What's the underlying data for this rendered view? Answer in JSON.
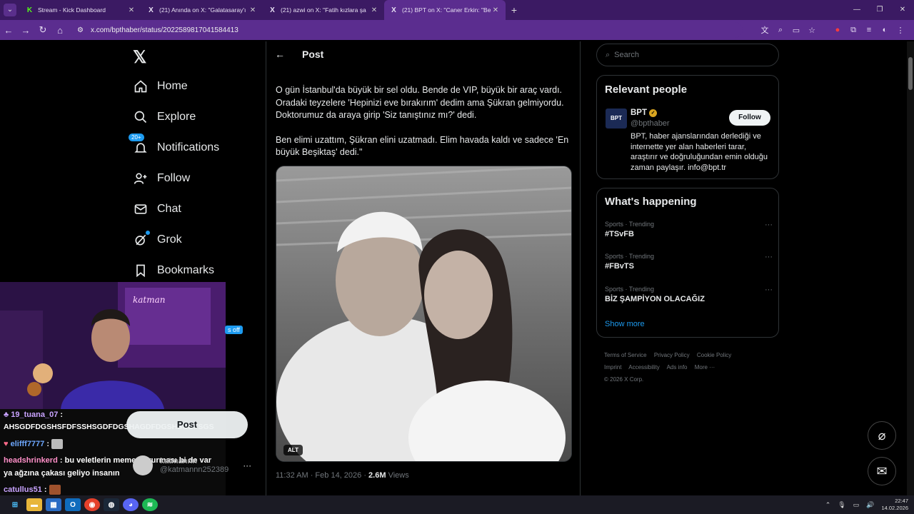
{
  "browser": {
    "tabs": [
      {
        "title": "Stream - Kick Dashboard",
        "favicon": "K",
        "active": false
      },
      {
        "title": "(21) Anında on X: \"Galatasaray'ı",
        "favicon": "X",
        "active": false
      },
      {
        "title": "(21) azwi on X: \"Fatih kızlara şa",
        "favicon": "X",
        "active": false
      },
      {
        "title": "(21) BPT on X: \"Caner Erkin: \"Be",
        "favicon": "X",
        "active": true
      }
    ],
    "url": "x.com/bpthaber/status/2022589817041584413",
    "accent": "#5b2d8f"
  },
  "nav": {
    "home": "Home",
    "explore": "Explore",
    "notifications": "Notifications",
    "notifications_badge": "20+",
    "follow": "Follow",
    "chat": "Chat",
    "grok": "Grok",
    "bookmarks": "Bookmarks"
  },
  "post": {
    "header": "Post",
    "paragraph1": "O gün İstanbul'da büyük bir sel oldu. Bende de VIP, büyük bir araç vardı. Oradaki teyzelere 'Hepinizi eve bırakırım' dedim ama Şükran gelmiyordu. Doktorumuz da araya girip 'Siz tanıştınız mı?' dedi.",
    "paragraph2": "Ben elimi uzattım, Şükran elini uzatmadı. Elim havada kaldı ve sadece 'En büyük Beşiktaş' dedi.\"",
    "alt_label": "ALT",
    "time": "11:32 AM · Feb 14, 2026 · ",
    "views_count": "2.6M",
    "views_label": " Views"
  },
  "sidebar": {
    "search_placeholder": "Search",
    "relevant_title": "Relevant people",
    "person": {
      "avatar_text": "BPT",
      "name": "BPT",
      "handle": "@bpthaber",
      "bio": "BPT, haber ajanslarından derlediği ve internette yer alan haberleri tarar, araştırır ve doğruluğundan emin olduğu zaman paylaşır. info@bpt.tr",
      "follow_label": "Follow"
    },
    "happening_title": "What's happening",
    "trends": [
      {
        "category": "Sports · Trending",
        "title": "#TSvFB"
      },
      {
        "category": "Sports · Trending",
        "title": "#FBvTS"
      },
      {
        "category": "Sports · Trending",
        "title": "BİZ ŞAMPİYON OLACAĞIZ"
      }
    ],
    "show_more": "Show more",
    "footer_links": [
      "Terms of Service",
      "Privacy Policy",
      "Cookie Policy",
      "Imprint",
      "Accessibility",
      "Ads info",
      "More ···"
    ],
    "copyright": "© 2026 X Corp."
  },
  "overlay": {
    "post_button": "Post",
    "account_name": "katmannn",
    "account_handle": "@katmannn252389",
    "webcam_sign": "katman",
    "offline_tag": "s off",
    "chat": [
      {
        "user": "19_tuana_07",
        "text": ":",
        "color": "#c9a3ff"
      },
      {
        "user": "",
        "text": "AHSGDFDGSHSFDFSSHSGDFDGSHAGDFDGSHSGDFSGS",
        "color": "#ffffff"
      },
      {
        "user": "elifff7777",
        "text": ":",
        "color": "#6ea8ff"
      },
      {
        "user": "headshrinkerd",
        "text": ": bu veletlerin memeye vurması bi de var",
        "color": "#ff8fc8"
      },
      {
        "user": "",
        "text": "ya ağzına çakası geliyo insanın",
        "color": "#ffffff"
      },
      {
        "user": "catullus51",
        "text": ":",
        "color": "#c9a3ff"
      }
    ]
  },
  "taskbar": {
    "time": "22:47",
    "date": "14.02.2026"
  }
}
